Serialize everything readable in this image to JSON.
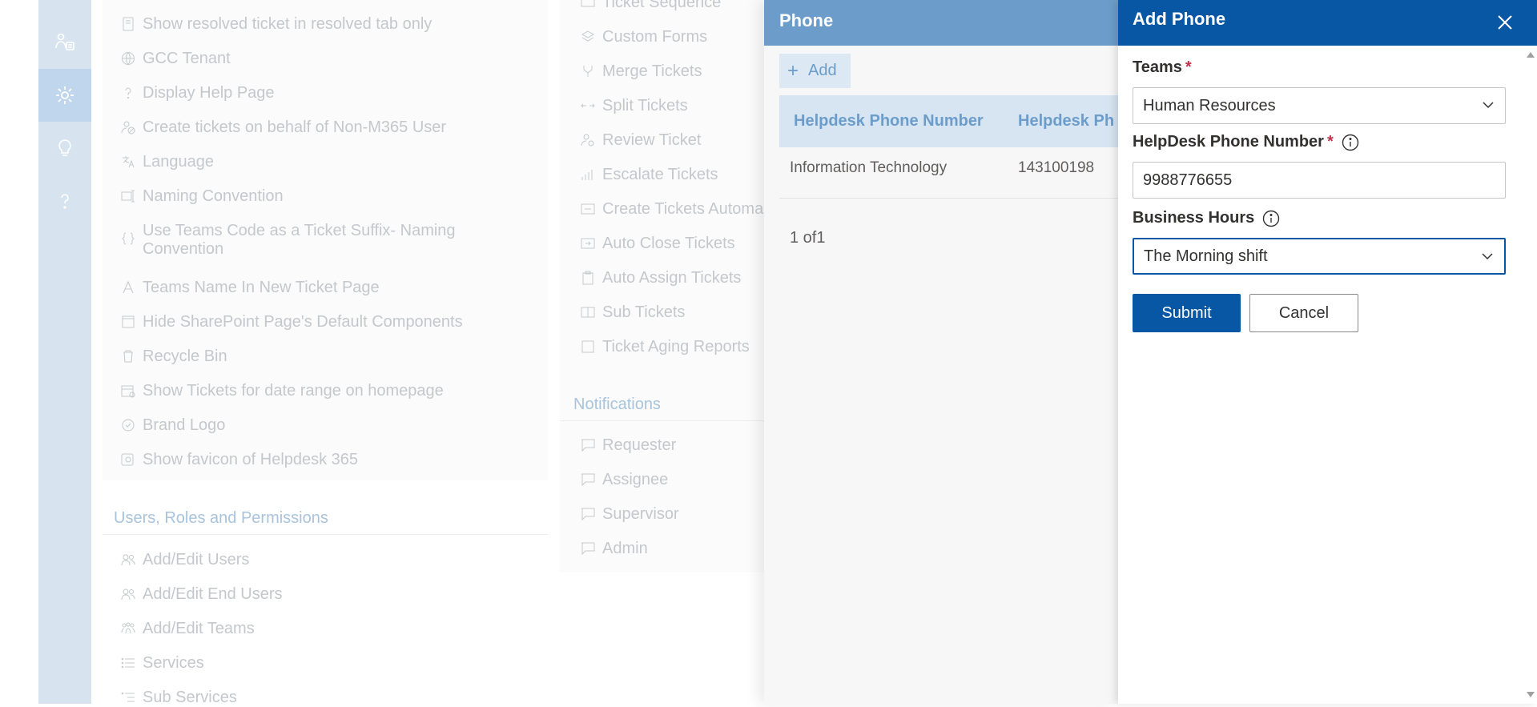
{
  "rail": {
    "items": [
      {
        "icon": "users-settings-icon"
      },
      {
        "icon": "gear-icon",
        "active": true
      },
      {
        "icon": "lightbulb-icon"
      },
      {
        "icon": "help-icon"
      }
    ]
  },
  "settings": {
    "general_items": [
      "Show resolved ticket in resolved tab only",
      "GCC Tenant",
      "Display Help Page",
      "Create tickets on behalf of Non-M365 User",
      "Language",
      "Naming Convention",
      "Use Teams Code as a Ticket Suffix- Naming Convention",
      "Teams Name In New Ticket Page",
      "Hide SharePoint Page's Default Components",
      "Recycle Bin",
      "Show Tickets for date range on homepage",
      "Brand Logo",
      "Show favicon of Helpdesk 365"
    ],
    "users_section_title": "Users, Roles and Permissions",
    "users_items": [
      "Add/Edit Users",
      "Add/Edit End Users",
      "Add/Edit Teams",
      "Services",
      "Sub Services"
    ],
    "ticket_items": [
      "Ticket Sequence",
      "Custom Forms",
      "Merge Tickets",
      "Split Tickets",
      "Review Ticket",
      "Escalate Tickets",
      "Create Tickets Automa",
      "Auto Close Tickets",
      "Auto Assign Tickets",
      "Sub Tickets",
      "Ticket Aging Reports"
    ],
    "notifications_title": "Notifications",
    "notification_items": [
      "Requester",
      "Assignee",
      "Supervisor",
      "Admin"
    ]
  },
  "phone_panel": {
    "title": "Phone",
    "add_label": "Add",
    "columns": [
      "Helpdesk Phone Number",
      "Helpdesk Ph"
    ],
    "rows": [
      [
        "Information Technology",
        "143100198"
      ]
    ],
    "pager": "1 of1"
  },
  "add_phone": {
    "title": "Add Phone",
    "teams_label": "Teams",
    "teams_value": "Human Resources",
    "phone_label": "HelpDesk Phone Number",
    "phone_value": "9988776655",
    "hours_label": "Business Hours",
    "hours_value": "The Morning shift",
    "required_mark": "*",
    "submit_label": "Submit",
    "cancel_label": "Cancel"
  },
  "colors": {
    "brand": "#0757a5",
    "required": "#c4314b",
    "phone_header": "#6c9dca"
  }
}
